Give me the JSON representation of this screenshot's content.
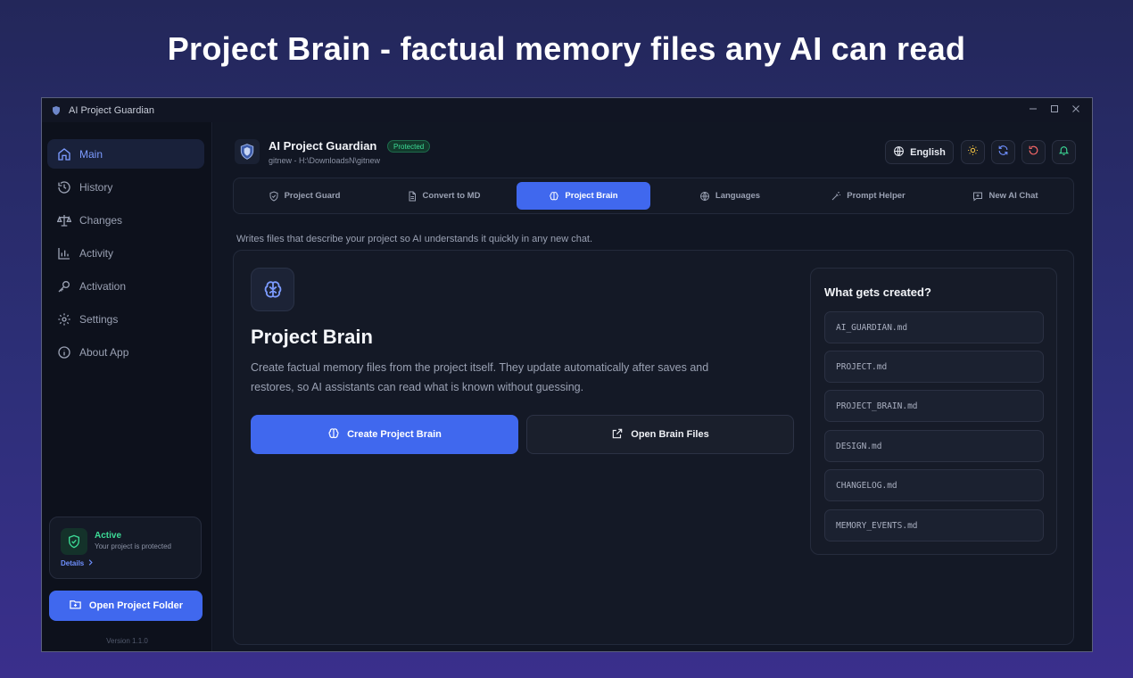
{
  "headline": "Project Brain - factual memory files any AI can read",
  "window": {
    "title": "AI Project Guardian"
  },
  "sidebar": {
    "items": [
      {
        "label": "Main",
        "icon": "home-icon",
        "active": true
      },
      {
        "label": "History",
        "icon": "history-icon"
      },
      {
        "label": "Changes",
        "icon": "scale-icon"
      },
      {
        "label": "Activity",
        "icon": "chart-icon"
      },
      {
        "label": "Activation",
        "icon": "key-icon"
      },
      {
        "label": "Settings",
        "icon": "gear-icon"
      },
      {
        "label": "About App",
        "icon": "info-icon"
      }
    ],
    "status": {
      "title": "Active",
      "subtitle": "Your project is protected",
      "link": "Details"
    },
    "open_folder_label": "Open Project Folder",
    "version": "Version 1.1.0"
  },
  "header": {
    "project_name": "AI Project Guardian",
    "badge": "Protected",
    "path": "gitnew - H:\\DownloadsN\\gitnew",
    "language": "English"
  },
  "tabs": [
    {
      "label": "Project Guard",
      "icon": "shield-check-icon"
    },
    {
      "label": "Convert to MD",
      "icon": "file-icon"
    },
    {
      "label": "Project Brain",
      "icon": "brain-icon",
      "active": true
    },
    {
      "label": "Languages",
      "icon": "globe-icon"
    },
    {
      "label": "Prompt Helper",
      "icon": "wand-icon"
    },
    {
      "label": "New AI Chat",
      "icon": "chat-plus-icon"
    }
  ],
  "description": "Writes files that describe your project so AI understands it quickly in any new chat.",
  "panel": {
    "title": "Project Brain",
    "text": "Create factual memory files from the project itself. They update automatically after saves and restores, so AI assistants can read what is known without guessing.",
    "create_label": "Create Project Brain",
    "open_label": "Open Brain Files"
  },
  "files": {
    "title": "What gets created?",
    "items": [
      "AI_GUARDIAN.md",
      "PROJECT.md",
      "PROJECT_BRAIN.md",
      "DESIGN.md",
      "CHANGELOG.md",
      "MEMORY_EVENTS.md"
    ]
  },
  "colors": {
    "accent": "#4068ee",
    "success": "#3ddc97",
    "warning": "#f5c542",
    "danger": "#ff6b6b"
  }
}
